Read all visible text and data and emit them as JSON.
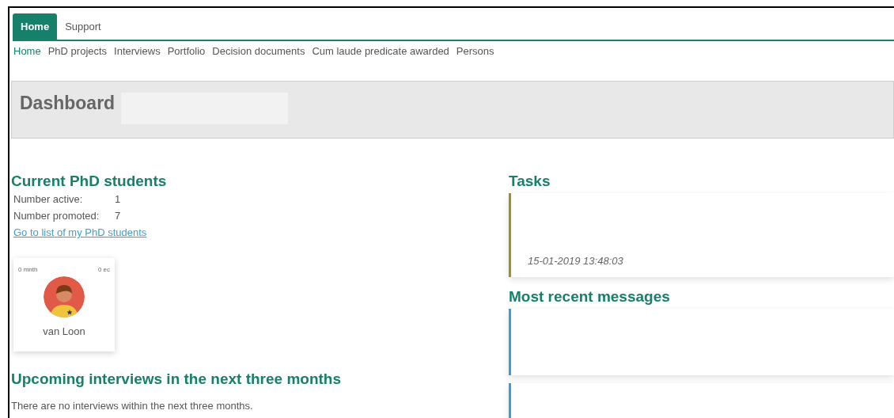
{
  "tabs": [
    {
      "label": "Home",
      "selected": true
    },
    {
      "label": "Support",
      "selected": false
    }
  ],
  "nav": [
    {
      "label": "Home",
      "selected": true
    },
    {
      "label": "PhD projects",
      "selected": false
    },
    {
      "label": "Interviews",
      "selected": false
    },
    {
      "label": "Portfolio",
      "selected": false
    },
    {
      "label": "Decision documents",
      "selected": false
    },
    {
      "label": "Cum laude predicate awarded",
      "selected": false
    },
    {
      "label": "Persons",
      "selected": false
    }
  ],
  "page_title": "Dashboard",
  "students": {
    "heading": "Current PhD students",
    "stats": [
      {
        "label": "Number active:",
        "value": "1"
      },
      {
        "label": "Number promoted:",
        "value": "7"
      }
    ],
    "link": "Go to list of my PhD students",
    "cards": [
      {
        "months": "0 mnth",
        "credits": "0 ec",
        "name": "van Loon"
      }
    ]
  },
  "interviews": {
    "heading": "Upcoming interviews in the next three months",
    "message": "There are no interviews within the next three months."
  },
  "tasks": {
    "heading": "Tasks",
    "items": [
      {
        "timestamp": "15-01-2019 13:48:03"
      }
    ]
  },
  "messages": {
    "heading": "Most recent messages",
    "items": [
      {
        "kind": "card"
      },
      {
        "kind": "card"
      }
    ]
  }
}
